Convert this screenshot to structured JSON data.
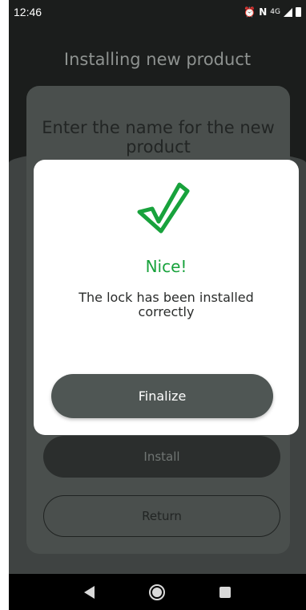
{
  "status_bar": {
    "time": "12:46",
    "alarm_icon": "alarm-icon",
    "nfc_icon": "nfc-icon",
    "network": "4G",
    "signal_icon": "signal-icon",
    "battery_icon": "battery-icon"
  },
  "header": {
    "title": "Installing new product"
  },
  "card": {
    "title": "Enter the name for the new product",
    "install_label": "Install",
    "return_label": "Return"
  },
  "dialog": {
    "icon": "checkmark-icon",
    "title": "Nice!",
    "message": "The lock has been installed correctly",
    "finalize_label": "Finalize",
    "accent_color": "#18a23c"
  },
  "nav_bar": {
    "back_icon": "back-icon",
    "home_icon": "home-icon",
    "recents_icon": "recents-icon"
  }
}
